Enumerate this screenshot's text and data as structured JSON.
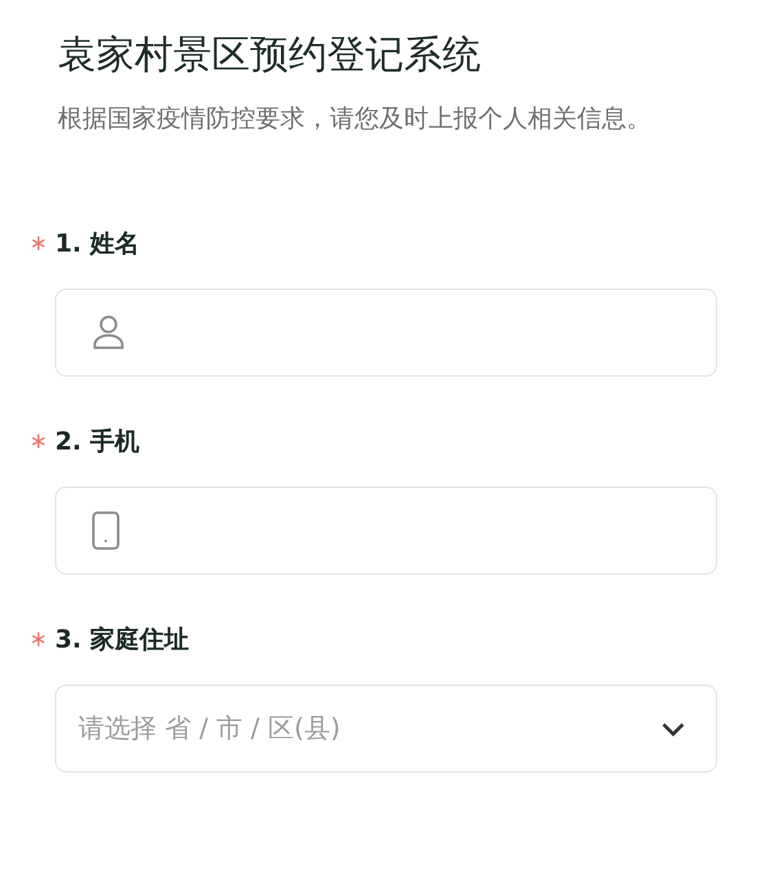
{
  "title": "袁家村景区预约登记系统",
  "subtitle": "根据国家疫情防控要求，请您及时上报个人相关信息。",
  "questions": [
    {
      "label": "1. 姓名",
      "required": true,
      "field": {
        "kind": "name"
      }
    },
    {
      "label": "2. 手机",
      "required": true,
      "field": {
        "kind": "phone"
      }
    },
    {
      "label": "3. 家庭住址",
      "required": true,
      "field": {
        "kind": "select",
        "placeholder": "请选择 省 / 市 / 区(县)"
      }
    }
  ]
}
